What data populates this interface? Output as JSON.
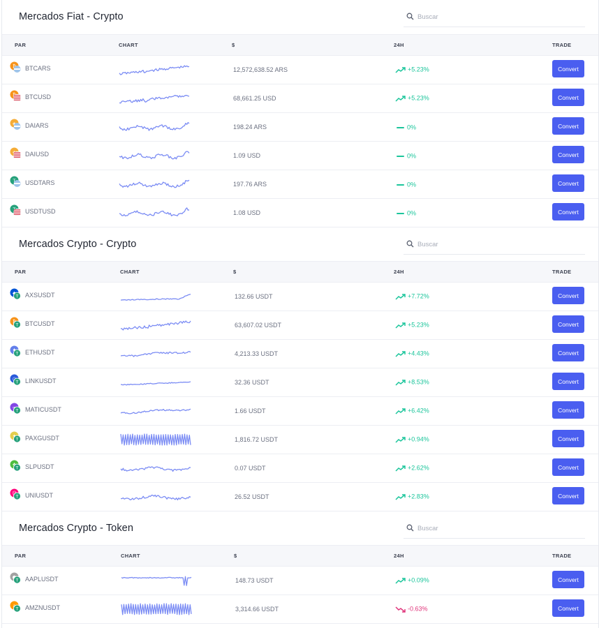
{
  "search_placeholder": "Buscar",
  "colors": {
    "positive": "#1bc59b",
    "negative": "#e0357b",
    "neutral": "#1bc59b",
    "accent": "#4a5ef0",
    "spark": "#7b8cf4"
  },
  "sections": [
    {
      "title": "Mercados Fiat - Crypto",
      "headers": {
        "pair": "PAR",
        "chart": "CHART",
        "price": "$",
        "change": "24H",
        "trade": "TRADE"
      },
      "rows": [
        {
          "pair": "BTCARS",
          "base": "btc",
          "quote": "ars",
          "spark": "up",
          "price": "12,572,638.52 ARS",
          "trend": "up",
          "change": "+5.23%",
          "action": "Convert"
        },
        {
          "pair": "BTCUSD",
          "base": "btc",
          "quote": "usd",
          "spark": "up",
          "price": "68,661.25 USD",
          "trend": "up",
          "change": "+5.23%",
          "action": "Convert"
        },
        {
          "pair": "DAIARS",
          "base": "dai",
          "quote": "ars",
          "spark": "wiggle",
          "price": "198.24 ARS",
          "trend": "flat",
          "change": "0%",
          "action": "Convert"
        },
        {
          "pair": "DAIUSD",
          "base": "dai",
          "quote": "usd",
          "spark": "wiggle",
          "price": "1.09 USD",
          "trend": "flat",
          "change": "0%",
          "action": "Convert"
        },
        {
          "pair": "USDTARS",
          "base": "usdt",
          "quote": "ars",
          "spark": "wiggle",
          "price": "197.76 ARS",
          "trend": "flat",
          "change": "0%",
          "action": "Convert"
        },
        {
          "pair": "USDTUSD",
          "base": "usdt",
          "quote": "usd",
          "spark": "wiggle",
          "price": "1.08 USD",
          "trend": "flat",
          "change": "0%",
          "action": "Convert"
        }
      ]
    },
    {
      "title": "Mercados Crypto - Crypto",
      "headers": {
        "pair": "PAR",
        "chart": "CHART",
        "price": "$",
        "change": "24H",
        "trade": "TRADE"
      },
      "rows": [
        {
          "pair": "AXSUSDT",
          "base": "axs",
          "quote": "usdt",
          "spark": "rise-late",
          "price": "132.66 USDT",
          "trend": "up",
          "change": "+7.72%",
          "action": "Convert"
        },
        {
          "pair": "BTCUSDT",
          "base": "btc",
          "quote": "usdt",
          "spark": "up",
          "price": "63,607.02 USDT",
          "trend": "up",
          "change": "+5.23%",
          "action": "Convert"
        },
        {
          "pair": "ETHUSDT",
          "base": "eth",
          "quote": "usdt",
          "spark": "up-soft",
          "price": "4,213.33 USDT",
          "trend": "up",
          "change": "+4.43%",
          "action": "Convert"
        },
        {
          "pair": "LINKUSDT",
          "base": "link",
          "quote": "usdt",
          "spark": "gentle",
          "price": "32.36 USDT",
          "trend": "up",
          "change": "+8.53%",
          "action": "Convert"
        },
        {
          "pair": "MATICUSDT",
          "base": "matic",
          "quote": "usdt",
          "spark": "up-soft",
          "price": "1.66 USDT",
          "trend": "up",
          "change": "+6.42%",
          "action": "Convert"
        },
        {
          "pair": "PAXGUSDT",
          "base": "paxg",
          "quote": "usdt",
          "spark": "zigzag",
          "price": "1,816.72 USDT",
          "trend": "up",
          "change": "+0.94%",
          "action": "Convert"
        },
        {
          "pair": "SLPUSDT",
          "base": "slp",
          "quote": "usdt",
          "spark": "bumpy",
          "price": "0.07 USDT",
          "trend": "up",
          "change": "+2.62%",
          "action": "Convert"
        },
        {
          "pair": "UNIUSDT",
          "base": "uni",
          "quote": "usdt",
          "spark": "bumpy",
          "price": "26.52 USDT",
          "trend": "up",
          "change": "+2.83%",
          "action": "Convert"
        }
      ]
    },
    {
      "title": "Mercados Crypto - Token",
      "headers": {
        "pair": "PAR",
        "chart": "CHART",
        "price": "$",
        "change": "24H",
        "trade": "TRADE"
      },
      "rows": [
        {
          "pair": "AAPLUSDT",
          "base": "aapl",
          "quote": "usdt",
          "spark": "spike",
          "price": "148.73 USDT",
          "trend": "up",
          "change": "+0.09%",
          "action": "Convert"
        },
        {
          "pair": "AMZNUSDT",
          "base": "amzn",
          "quote": "usdt",
          "spark": "zigzag",
          "price": "3,314.66 USDT",
          "trend": "down",
          "change": "-0.63%",
          "action": "Convert"
        }
      ]
    }
  ]
}
